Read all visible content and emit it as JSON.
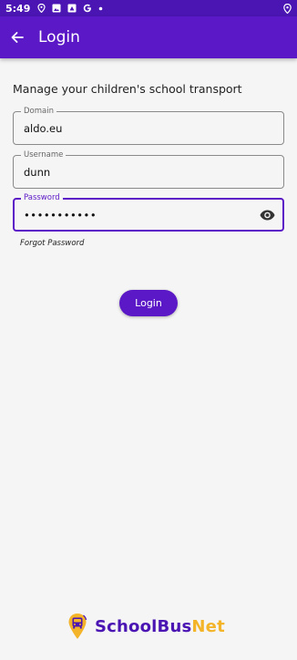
{
  "status_bar": {
    "time": "5:49",
    "icons": [
      "location-pin-icon",
      "image-icon",
      "photo-icon",
      "google-icon",
      "dot-icon",
      "location-icon"
    ]
  },
  "app_bar": {
    "title": "Login",
    "back_icon": "arrow-left-icon"
  },
  "form": {
    "subtitle": "Manage your children's school transport",
    "domain": {
      "label": "Domain",
      "value": "aldo.eu"
    },
    "username": {
      "label": "Username",
      "value": "dunn"
    },
    "password": {
      "label": "Password",
      "value": "•••••••••••",
      "toggle_icon": "eye-icon"
    },
    "forgot_password": "Forgot Password",
    "login_button": "Login"
  },
  "brand": {
    "logo_icon": "school-bus-pin-icon",
    "name_part1": "SchoolBus",
    "name_part2": "Net"
  },
  "colors": {
    "primary": "#5b18c6",
    "status_bar": "#4a15b3",
    "accent": "#f3b42a",
    "background": "#f5f5f5"
  }
}
